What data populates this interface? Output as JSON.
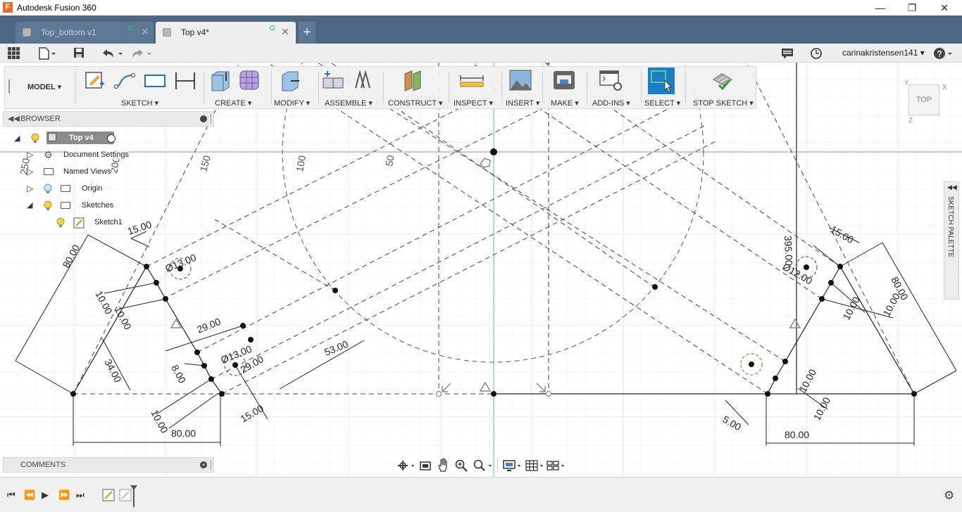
{
  "window": {
    "title": "Autodesk Fusion 360",
    "app_icon_letter": "F"
  },
  "tabs": [
    {
      "label": "Top_bottom v1",
      "active": false
    },
    {
      "label": "Top v4*",
      "active": true
    }
  ],
  "new_tab_label": "+",
  "user": {
    "name": "carinakristensen141 ▾"
  },
  "toolbar": {
    "workspace": "MODEL ▾",
    "groups": [
      {
        "label": "SKETCH ▾"
      },
      {
        "label": "CREATE ▾"
      },
      {
        "label": "MODIFY ▾"
      },
      {
        "label": "ASSEMBLE ▾"
      },
      {
        "label": "CONSTRUCT ▾"
      },
      {
        "label": "INSPECT ▾"
      },
      {
        "label": "INSERT ▾"
      },
      {
        "label": "MAKE ▾"
      },
      {
        "label": "ADD-INS ▾"
      },
      {
        "label": "SELECT ▾"
      },
      {
        "label": "STOP SKETCH ▾"
      }
    ]
  },
  "browser": {
    "title": "BROWSER",
    "root": "Top v4",
    "items": [
      {
        "label": "Document Settings"
      },
      {
        "label": "Named Views"
      },
      {
        "label": "Origin"
      },
      {
        "label": "Sketches"
      },
      {
        "label": "Sketch1"
      }
    ]
  },
  "comments": {
    "title": "COMMENTS"
  },
  "viewcube": {
    "face": "TOP",
    "axis_x": "X",
    "axis_y": "Y",
    "axis_z": "Z"
  },
  "sketch_palette": {
    "title": "SKETCH PALETTE"
  },
  "dimensions": {
    "d1": "15.00",
    "d2": "80.00",
    "d3": "Ø13.00",
    "d4": "10.00",
    "d5": "10.00",
    "d6": "29.00",
    "d7": "34.00",
    "d8": "Ø13.00",
    "d9": "29.00",
    "d10": "8.00",
    "d11": "53.00",
    "d12": "15.00",
    "d13": "10.00",
    "d14": "80.00",
    "d15": "15.00",
    "d16": "395.00",
    "d17": "Ø12.00",
    "d18": "80.00",
    "d19": "10.00",
    "d20": "10.00",
    "d21": "10.00",
    "d22": "10.00",
    "d23": "5.00",
    "d24": "80.00",
    "d25": "150",
    "d26": "100",
    "d27": "50",
    "d28": "250",
    "d29": "200"
  }
}
